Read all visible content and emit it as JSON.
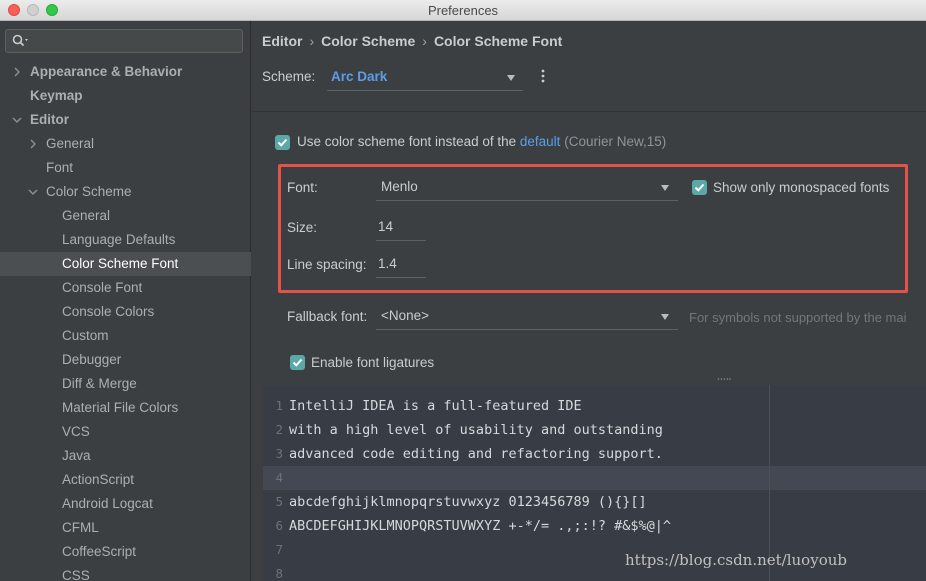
{
  "window": {
    "title": "Preferences"
  },
  "sidebar": {
    "search": {
      "placeholder": "",
      "value": ""
    },
    "items": [
      {
        "label": "Appearance & Behavior",
        "level": 0,
        "expander": "collapsed",
        "bold": true
      },
      {
        "label": "Keymap",
        "level": 0,
        "expander": "none",
        "bold": true
      },
      {
        "label": "Editor",
        "level": 0,
        "expander": "expanded",
        "bold": true
      },
      {
        "label": "General",
        "level": 1,
        "expander": "collapsed"
      },
      {
        "label": "Font",
        "level": 1,
        "expander": "none"
      },
      {
        "label": "Color Scheme",
        "level": 1,
        "expander": "expanded"
      },
      {
        "label": "General",
        "level": 2,
        "expander": "none"
      },
      {
        "label": "Language Defaults",
        "level": 2,
        "expander": "none"
      },
      {
        "label": "Color Scheme Font",
        "level": 2,
        "expander": "none",
        "selected": true
      },
      {
        "label": "Console Font",
        "level": 2,
        "expander": "none"
      },
      {
        "label": "Console Colors",
        "level": 2,
        "expander": "none"
      },
      {
        "label": "Custom",
        "level": 2,
        "expander": "none"
      },
      {
        "label": "Debugger",
        "level": 2,
        "expander": "none"
      },
      {
        "label": "Diff & Merge",
        "level": 2,
        "expander": "none"
      },
      {
        "label": "Material File Colors",
        "level": 2,
        "expander": "none"
      },
      {
        "label": "VCS",
        "level": 2,
        "expander": "none"
      },
      {
        "label": "Java",
        "level": 2,
        "expander": "none"
      },
      {
        "label": "ActionScript",
        "level": 2,
        "expander": "none"
      },
      {
        "label": "Android Logcat",
        "level": 2,
        "expander": "none"
      },
      {
        "label": "CFML",
        "level": 2,
        "expander": "none"
      },
      {
        "label": "CoffeeScript",
        "level": 2,
        "expander": "none"
      },
      {
        "label": "CSS",
        "level": 2,
        "expander": "none"
      }
    ]
  },
  "breadcrumb": [
    "Editor",
    "Color Scheme",
    "Color Scheme Font"
  ],
  "scheme": {
    "label": "Scheme:",
    "value": "Arc Dark"
  },
  "use_scheme_font": {
    "checked": true,
    "text": "Use color scheme font instead of the",
    "link": "default",
    "default_font": "(Courier New,15)"
  },
  "font": {
    "label": "Font:",
    "value": "Menlo"
  },
  "monospaced": {
    "checked": true,
    "label": "Show only monospaced fonts"
  },
  "size": {
    "label": "Size:",
    "value": "14"
  },
  "line_spacing": {
    "label": "Line spacing:",
    "value": "1.4"
  },
  "fallback": {
    "label": "Fallback font:",
    "value": "<None>",
    "hint": "For symbols not supported by the mai"
  },
  "ligatures": {
    "checked": true,
    "label": "Enable font ligatures"
  },
  "preview": {
    "current_line": 4,
    "lines": [
      {
        "num": "1",
        "text": "IntelliJ IDEA is a full-featured IDE"
      },
      {
        "num": "2",
        "text": "with a high level of usability and outstanding"
      },
      {
        "num": "3",
        "text": "advanced code editing and refactoring support."
      },
      {
        "num": "4",
        "text": ""
      },
      {
        "num": "5",
        "text": "abcdefghijklmnopqrstuvwxyz 0123456789 (){}[]"
      },
      {
        "num": "6",
        "text": "ABCDEFGHIJKLMNOPQRSTUVWXYZ +-*/= .,;:!? #&$%@|^"
      },
      {
        "num": "7",
        "text": ""
      },
      {
        "num": "8",
        "text": ""
      }
    ]
  },
  "watermark": "https://blog.csdn.net/luoyoub",
  "colors": {
    "accent_link": "#5c9ee8",
    "checkbox": "#5aa9a7",
    "highlight_box": "#e5524a",
    "selection": "#4b4f52"
  }
}
